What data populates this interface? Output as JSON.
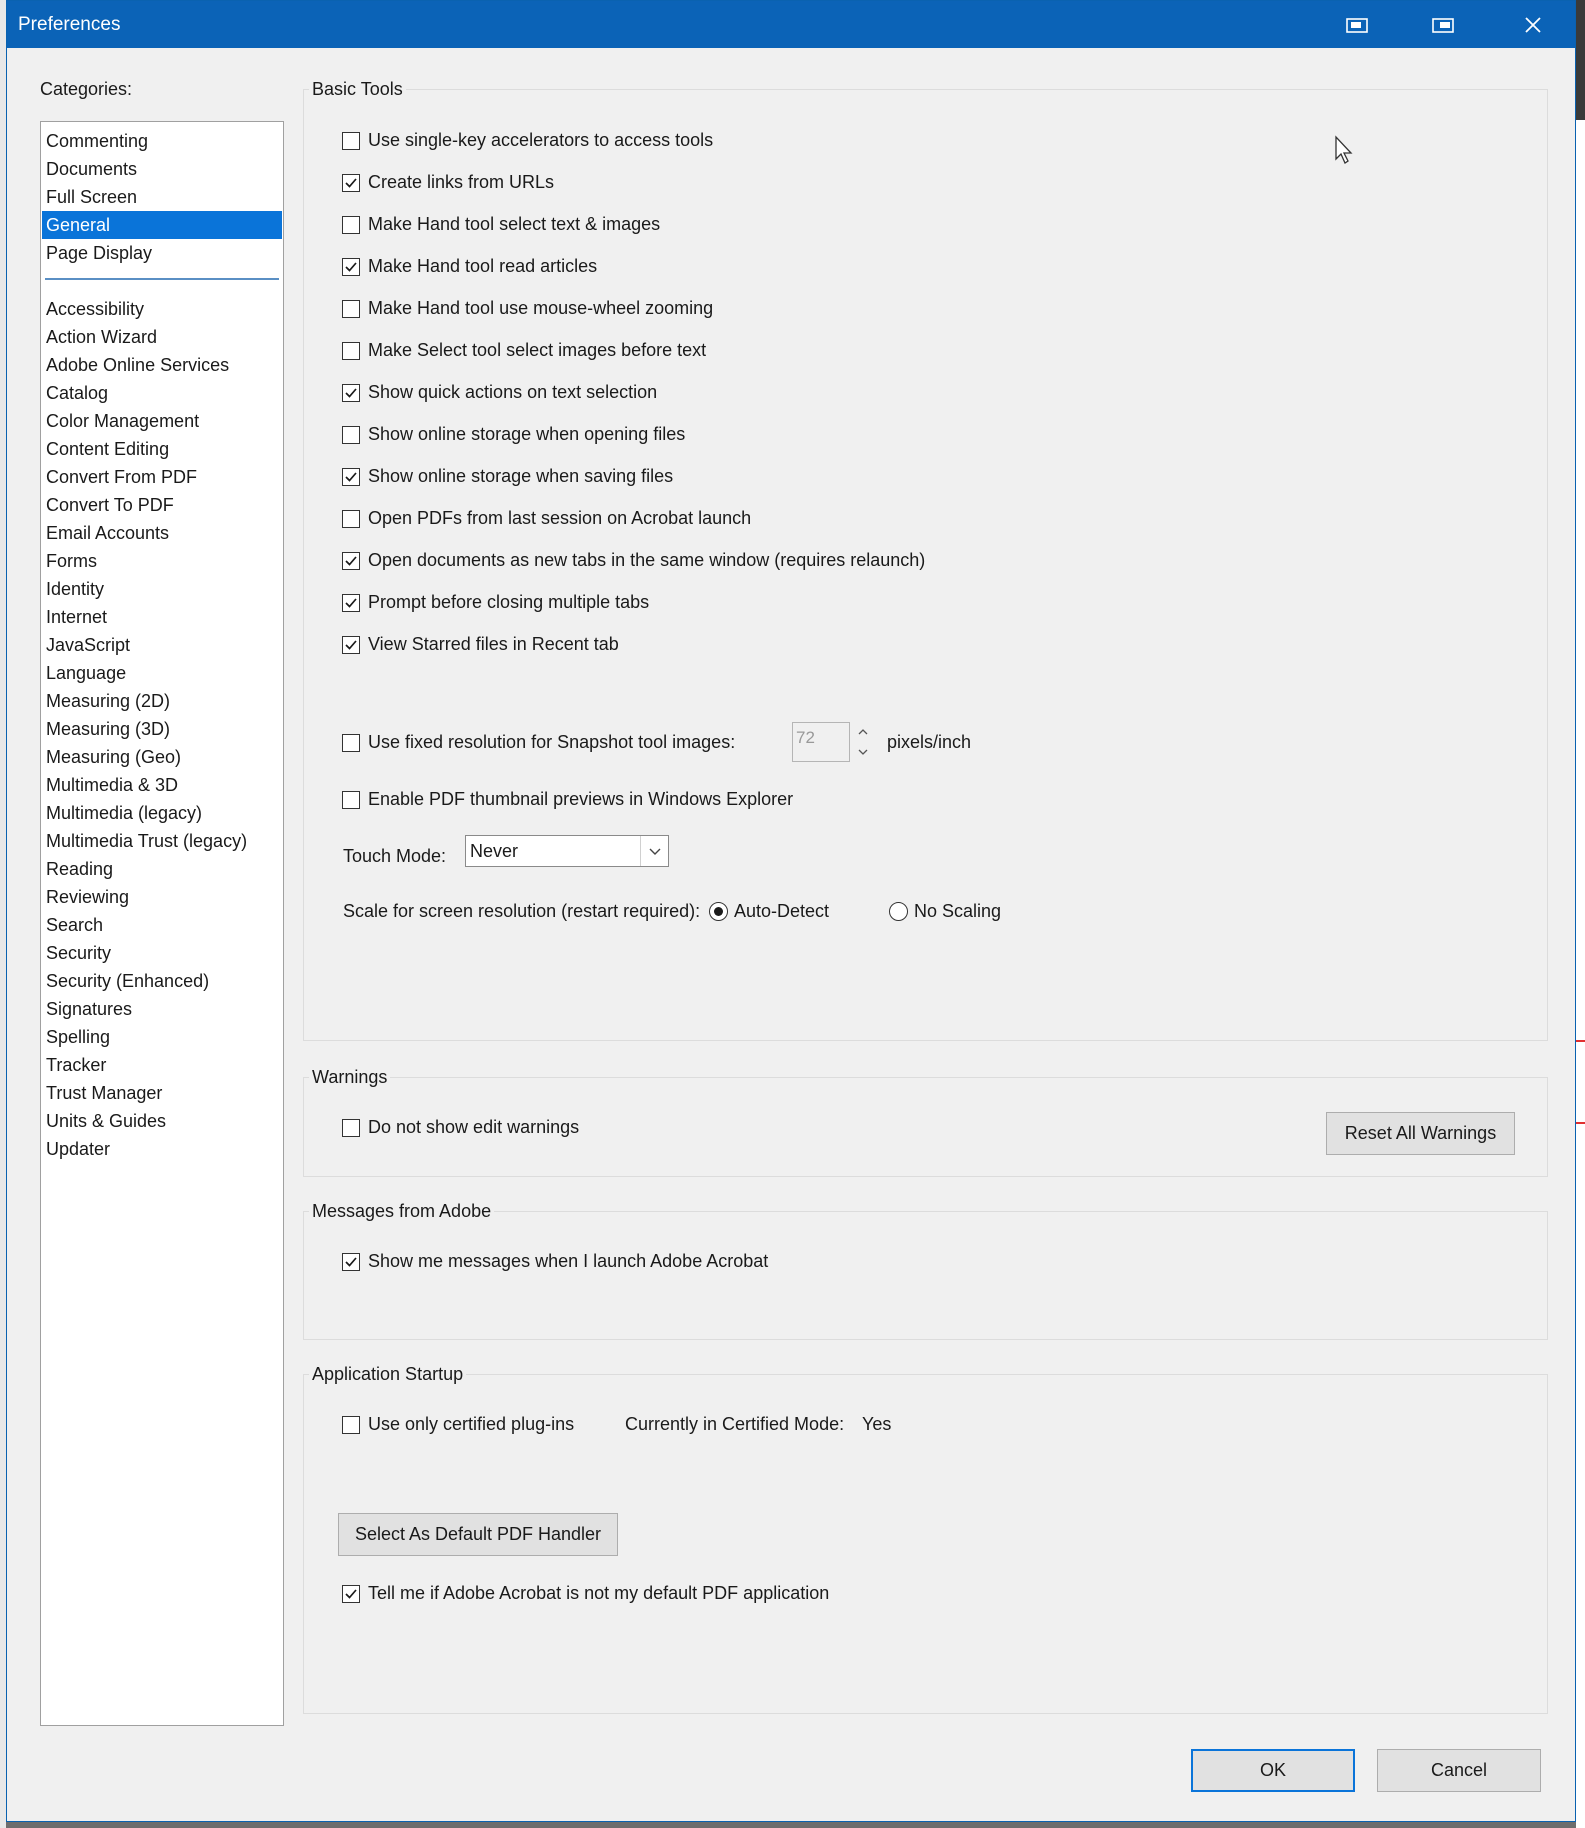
{
  "window": {
    "title": "Preferences"
  },
  "categories": {
    "label": "Categories:",
    "top_items": [
      {
        "label": "Commenting",
        "selected": false
      },
      {
        "label": "Documents",
        "selected": false
      },
      {
        "label": "Full Screen",
        "selected": false
      },
      {
        "label": "General",
        "selected": true
      },
      {
        "label": "Page Display",
        "selected": false
      }
    ],
    "items": [
      "Accessibility",
      "Action Wizard",
      "Adobe Online Services",
      "Catalog",
      "Color Management",
      "Content Editing",
      "Convert From PDF",
      "Convert To PDF",
      "Email Accounts",
      "Forms",
      "Identity",
      "Internet",
      "JavaScript",
      "Language",
      "Measuring (2D)",
      "Measuring (3D)",
      "Measuring (Geo)",
      "Multimedia & 3D",
      "Multimedia (legacy)",
      "Multimedia Trust (legacy)",
      "Reading",
      "Reviewing",
      "Search",
      "Security",
      "Security (Enhanced)",
      "Signatures",
      "Spelling",
      "Tracker",
      "Trust Manager",
      "Units & Guides",
      "Updater"
    ]
  },
  "basic_tools": {
    "title": "Basic Tools",
    "options": [
      {
        "label": "Use single-key accelerators to access tools",
        "checked": false
      },
      {
        "label": "Create links from URLs",
        "checked": true
      },
      {
        "label": "Make Hand tool select text & images",
        "checked": false
      },
      {
        "label": "Make Hand tool read articles",
        "checked": true
      },
      {
        "label": "Make Hand tool use mouse-wheel zooming",
        "checked": false
      },
      {
        "label": "Make Select tool select images before text",
        "checked": false
      },
      {
        "label": "Show quick actions on text selection",
        "checked": true
      },
      {
        "label": "Show online storage when opening files",
        "checked": false
      },
      {
        "label": "Show online storage when saving files",
        "checked": true
      },
      {
        "label": "Open PDFs from last session on Acrobat launch",
        "checked": false
      },
      {
        "label": "Open documents as new tabs in the same window (requires relaunch)",
        "checked": true
      },
      {
        "label": "Prompt before closing multiple tabs",
        "checked": true
      },
      {
        "label": "View Starred files in Recent tab",
        "checked": true
      }
    ],
    "snapshot": {
      "label": "Use fixed resolution for Snapshot tool images:",
      "checked": false,
      "value": "72",
      "unit": "pixels/inch"
    },
    "thumbnail": {
      "label": "Enable PDF thumbnail previews in Windows Explorer",
      "checked": false
    },
    "touch_mode": {
      "label": "Touch Mode:",
      "value": "Never"
    },
    "scale": {
      "label": "Scale for screen resolution (restart required):",
      "auto": "Auto-Detect",
      "none": "No Scaling",
      "selected": "auto"
    }
  },
  "warnings": {
    "title": "Warnings",
    "option": {
      "label": "Do not show edit warnings",
      "checked": false
    },
    "reset_button": "Reset All Warnings"
  },
  "messages": {
    "title": "Messages from Adobe",
    "option": {
      "label": "Show me messages when I launch Adobe Acrobat",
      "checked": true
    }
  },
  "startup": {
    "title": "Application Startup",
    "certified": {
      "label": "Use only certified plug-ins",
      "checked": false
    },
    "mode_label": "Currently in Certified Mode:",
    "mode_value": "Yes",
    "default_button": "Select As Default PDF Handler",
    "tell_me": {
      "label": "Tell me if Adobe Acrobat is not my default PDF application",
      "checked": true
    }
  },
  "footer": {
    "ok": "OK",
    "cancel": "Cancel"
  }
}
